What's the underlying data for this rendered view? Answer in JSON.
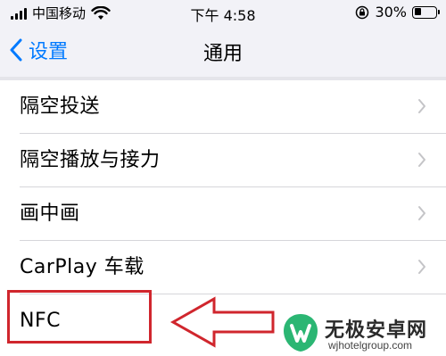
{
  "status_bar": {
    "carrier": "中国移动",
    "time": "下午 4:58",
    "battery_percent": "30%",
    "battery_level": 0.3,
    "icons": [
      "signal-icon",
      "wifi-icon",
      "rotation-lock-icon",
      "battery-icon"
    ]
  },
  "nav": {
    "back_label": "设置",
    "title": "通用",
    "accent_color": "#007aff"
  },
  "list": {
    "items": [
      {
        "label": "隔空投送"
      },
      {
        "label": "隔空播放与接力"
      },
      {
        "label": "画中画"
      },
      {
        "label": "CarPlay 车载"
      },
      {
        "label": "NFC"
      }
    ]
  },
  "annotation": {
    "color": "#d0262d",
    "icons": [
      "highlight-box",
      "arrow-left-icon"
    ]
  },
  "watermark": {
    "title": "无极安卓网",
    "url": "wjhotelgroup.com",
    "brand_color": "#2bb673"
  }
}
